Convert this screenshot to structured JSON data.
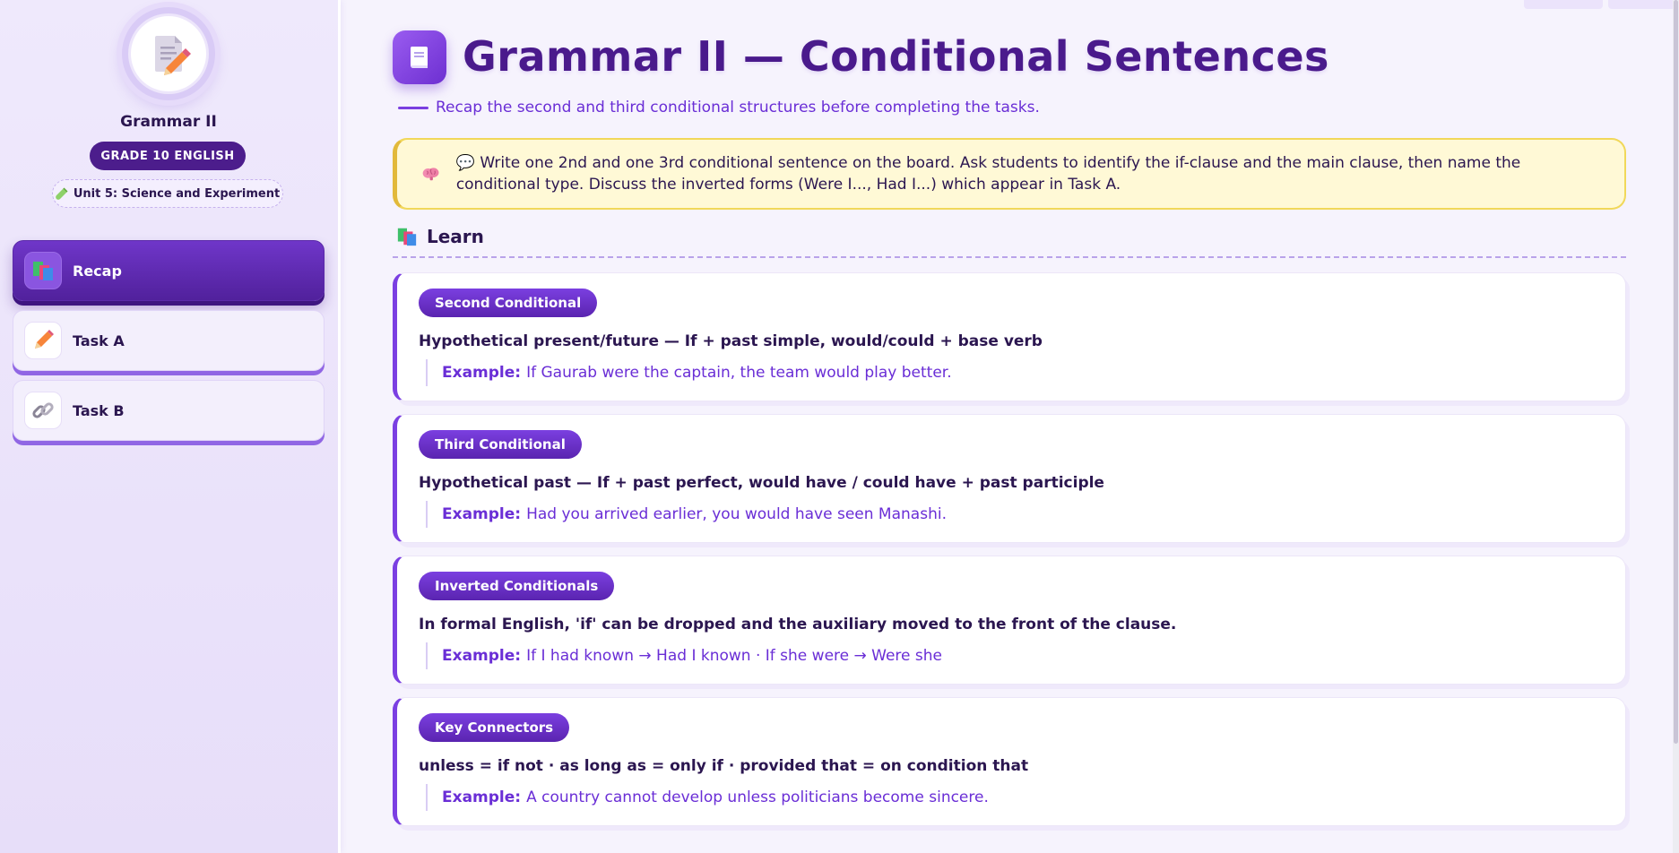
{
  "sidebar": {
    "lesson_title": "Grammar II",
    "grade": "GRADE 10 ENGLISH",
    "unit": "Unit 5: Science and Experiment",
    "items": [
      {
        "label": "Recap",
        "icon": "books-icon",
        "active": true
      },
      {
        "label": "Task A",
        "icon": "pencil-icon",
        "active": false
      },
      {
        "label": "Task B",
        "icon": "link-icon",
        "active": false
      }
    ]
  },
  "main": {
    "title": "Grammar II — Conditional Sentences",
    "subtitle": "Recap the second and third conditional structures before completing the tasks.",
    "teacher_note": "💬 Write one 2nd and one 3rd conditional sentence on the board. Ask students to identify the if-clause and the main clause, then name the conditional type. Discuss the inverted forms (Were I..., Had I...) which appear in Task A.",
    "section_title": "Learn",
    "example_label": "Example:",
    "cards": [
      {
        "tag": "Second Conditional",
        "rule": "Hypothetical present/future — If + past simple, would/could + base verb",
        "example": "If Gaurab were the captain, the team would play better."
      },
      {
        "tag": "Third Conditional",
        "rule": "Hypothetical past — If + past perfect, would have / could have + past participle",
        "example": "Had you arrived earlier, you would have seen Manashi."
      },
      {
        "tag": "Inverted Conditionals",
        "rule": "In formal English, 'if' can be dropped and the auxiliary moved to the front of the clause.",
        "example": "If I had known → Had I known · If she were → Were she"
      },
      {
        "tag": "Key Connectors",
        "rule": "unless = if not · as long as = only if · provided that = on condition that",
        "example": "A country cannot develop unless politicians become sincere."
      }
    ]
  },
  "colors": {
    "accent": "#6a2ed6",
    "accent_dark": "#4a1a8c",
    "note_bg": "#fff9d6",
    "note_border": "#f1d85a"
  }
}
